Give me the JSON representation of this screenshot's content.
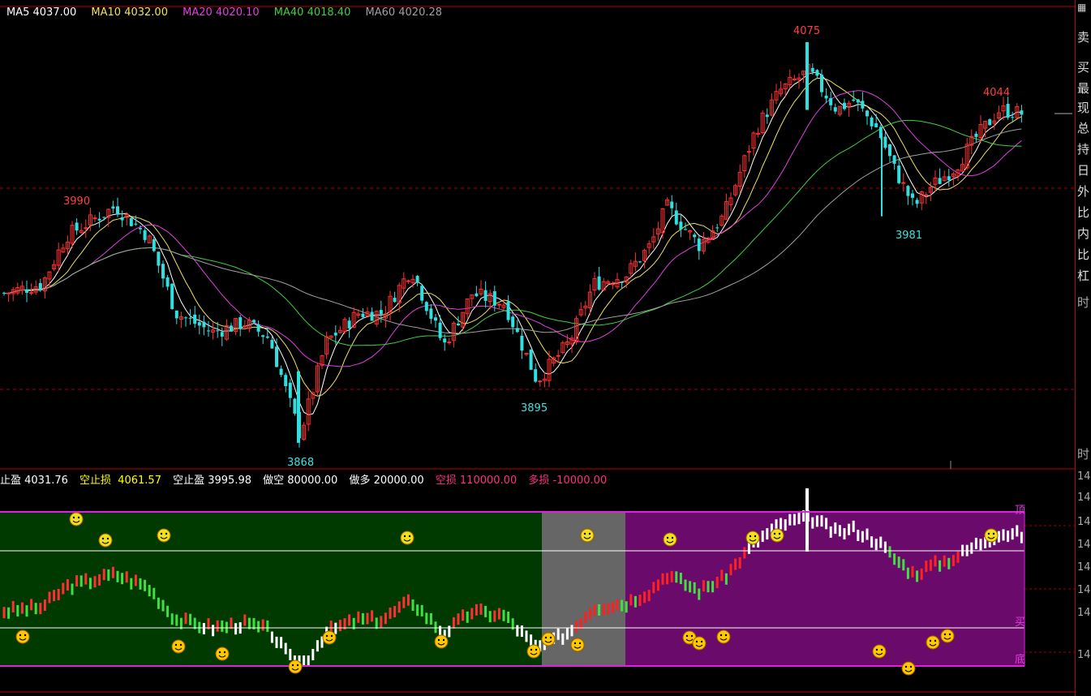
{
  "ma_legend": [
    {
      "label": "MA5 4037.00",
      "color": "#ffffff"
    },
    {
      "label": "MA10 4032.00",
      "color": "#f0e060"
    },
    {
      "label": "MA20 4020.10",
      "color": "#e040e0"
    },
    {
      "label": "MA40 4018.40",
      "color": "#40d040"
    },
    {
      "label": "MA60 4020.28",
      "color": "#a0a0a0"
    }
  ],
  "indicator_legend": [
    {
      "label": "止盈 4031.76",
      "color": "#ffffff"
    },
    {
      "label": "空止损",
      "color": "#ffff00"
    },
    {
      "label": "4061.57",
      "color": "#ffff00"
    },
    {
      "label": "空止盈 3995.98",
      "color": "#ffffff"
    },
    {
      "label": "做空 80000.00",
      "color": "#ffffff"
    },
    {
      "label": "做多 20000.00",
      "color": "#ffffff"
    },
    {
      "label": "空损 110000.00",
      "color": "#ff3080"
    },
    {
      "label": "多损 -10000.00",
      "color": "#ff3080"
    }
  ],
  "extremes": [
    {
      "label": "4075",
      "color": "#ff4040"
    },
    {
      "label": "3990",
      "color": "#ff4040"
    },
    {
      "label": "4044",
      "color": "#ff4040"
    },
    {
      "label": "3981",
      "color": "#40e0e0"
    },
    {
      "label": "3895",
      "color": "#40e0e0"
    },
    {
      "label": "3868",
      "color": "#40e0e0"
    }
  ],
  "side_panel": [
    "卖",
    "买",
    "最",
    "现",
    "总",
    "持",
    "日",
    "外",
    "比",
    "内",
    "比",
    "杠",
    "时",
    "时",
    "14",
    "14",
    "14",
    "14",
    "14",
    "14",
    "14",
    "14"
  ],
  "indicator_zone_labels": {
    "top": "顶",
    "buy": "买",
    "bottom": "底"
  },
  "colors": {
    "up": "#ff3030",
    "down": "#30e0e0",
    "bg_green": "#003a00",
    "bg_gray": "#666666",
    "bg_purple": "#6a0a6a",
    "band": "#e020e0"
  },
  "chart_data": {
    "type": "candlestick",
    "price_range": [
      3860,
      4080
    ],
    "annotated_highs": [
      3990,
      4075,
      4044
    ],
    "annotated_lows": [
      3868,
      3895,
      3981
    ],
    "moving_averages": {
      "MA5": 4037.0,
      "MA10": 4032.0,
      "MA20": 4020.1,
      "MA40": 4018.4,
      "MA60": 4020.28
    },
    "indicator_values": {
      "止盈": 4031.76,
      "空止损": 4061.57,
      "空止盈": 3995.98,
      "做空": 80000.0,
      "做多": 20000.0,
      "空损": 110000.0,
      "多损": -10000.0
    }
  }
}
